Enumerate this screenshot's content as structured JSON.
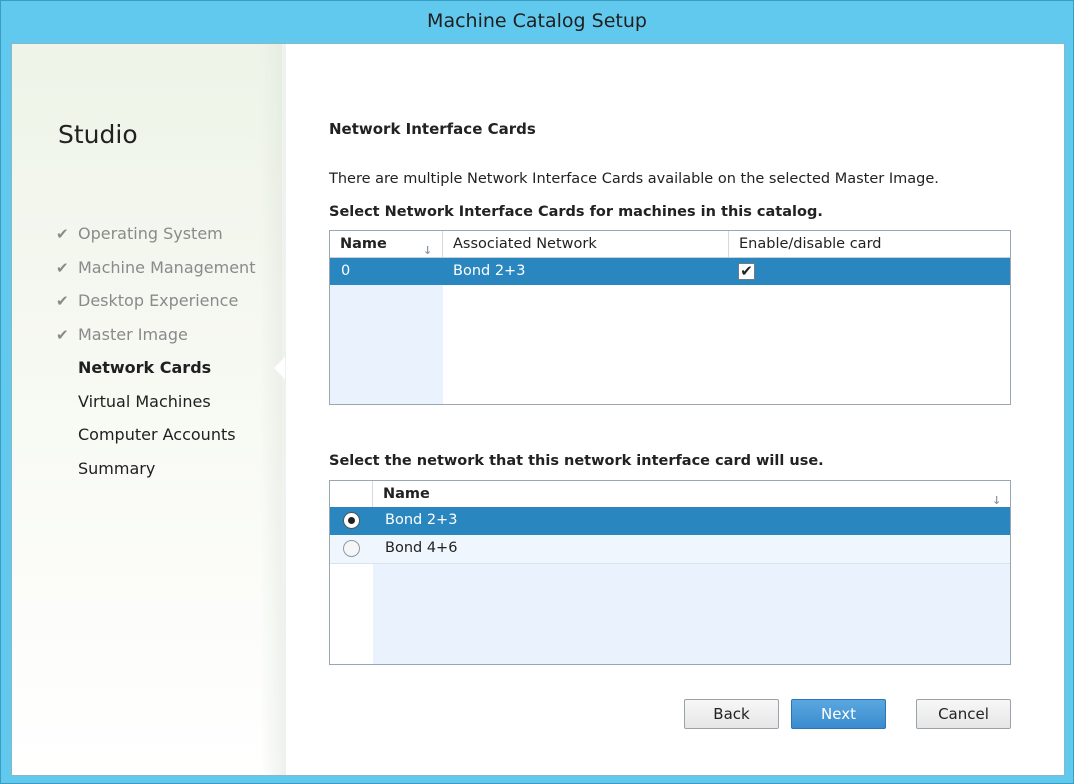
{
  "window": {
    "title": "Machine Catalog Setup"
  },
  "sidebar": {
    "brand": "Studio",
    "steps": [
      {
        "label": "Operating System",
        "state": "done"
      },
      {
        "label": "Machine Management",
        "state": "done"
      },
      {
        "label": "Desktop Experience",
        "state": "done"
      },
      {
        "label": "Master Image",
        "state": "done"
      },
      {
        "label": "Network Cards",
        "state": "active"
      },
      {
        "label": "Virtual Machines",
        "state": "pending"
      },
      {
        "label": "Computer Accounts",
        "state": "pending"
      },
      {
        "label": "Summary",
        "state": "pending"
      }
    ],
    "check_glyph": "✔"
  },
  "main": {
    "heading": "Network Interface Cards",
    "description": "There are multiple Network Interface Cards available on the selected Master Image.",
    "nic_prompt": "Select Network Interface Cards for machines in this catalog.",
    "nic_table": {
      "columns": [
        "Name",
        "Associated Network",
        "Enable/disable card"
      ],
      "rows": [
        {
          "name": "0",
          "network": "Bond 2+3",
          "enabled": true,
          "selected": true
        }
      ]
    },
    "network_prompt": "Select the network that this network interface card will use.",
    "network_table": {
      "columns": [
        "Name"
      ],
      "rows": [
        {
          "name": "Bond 2+3",
          "selected": true
        },
        {
          "name": "Bond 4+6",
          "selected": false
        }
      ]
    }
  },
  "footer": {
    "back_label": "Back",
    "next_label": "Next",
    "cancel_label": "Cancel"
  },
  "colors": {
    "title_bar": "#62c9ee",
    "selection": "#2a86bf",
    "primary_button": "#3a8bcf"
  }
}
